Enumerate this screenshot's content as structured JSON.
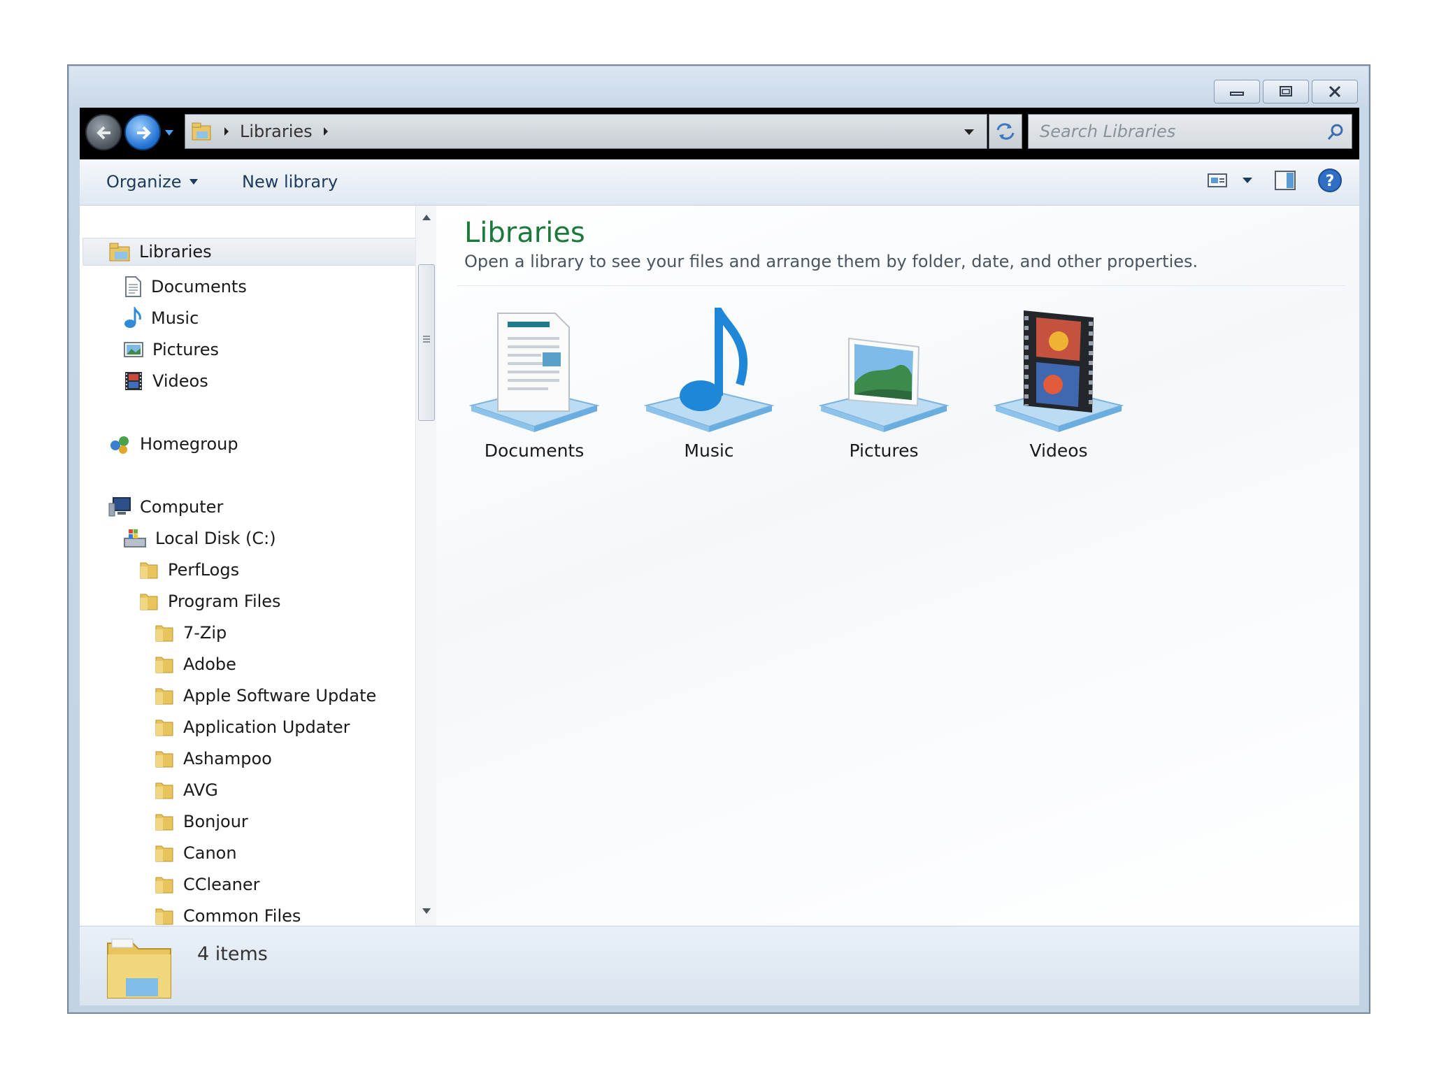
{
  "window": {
    "caption": {
      "minimize": "minimize",
      "maximize": "maximize",
      "close": "close"
    }
  },
  "address_bar": {
    "breadcrumb": [
      "Libraries"
    ],
    "search_placeholder": "Search Libraries"
  },
  "toolbar": {
    "organize_label": "Organize",
    "new_library_label": "New library"
  },
  "nav_tree": {
    "libraries": "Libraries",
    "library_items": [
      "Documents",
      "Music",
      "Pictures",
      "Videos"
    ],
    "homegroup": "Homegroup",
    "computer": "Computer",
    "local_disk": "Local Disk (C:)",
    "root_folders": [
      "PerfLogs",
      "Program Files"
    ],
    "program_files_folders": [
      "7-Zip",
      "Adobe",
      "Apple Software Update",
      "Application Updater",
      "Ashampoo",
      "AVG",
      "Bonjour",
      "Canon",
      "CCleaner",
      "Common Files"
    ]
  },
  "content": {
    "title": "Libraries",
    "subtitle": "Open a library to see your files and arrange them by folder, date, and other properties.",
    "libraries": [
      {
        "label": "Documents",
        "icon": "documents-library-icon"
      },
      {
        "label": "Music",
        "icon": "music-library-icon"
      },
      {
        "label": "Pictures",
        "icon": "pictures-library-icon"
      },
      {
        "label": "Videos",
        "icon": "videos-library-icon"
      }
    ]
  },
  "details": {
    "item_count": "4 items"
  },
  "colors": {
    "title_green": "#1b7a3a",
    "nav_black": "#000000",
    "folder_yellow": "#e8c45c"
  }
}
